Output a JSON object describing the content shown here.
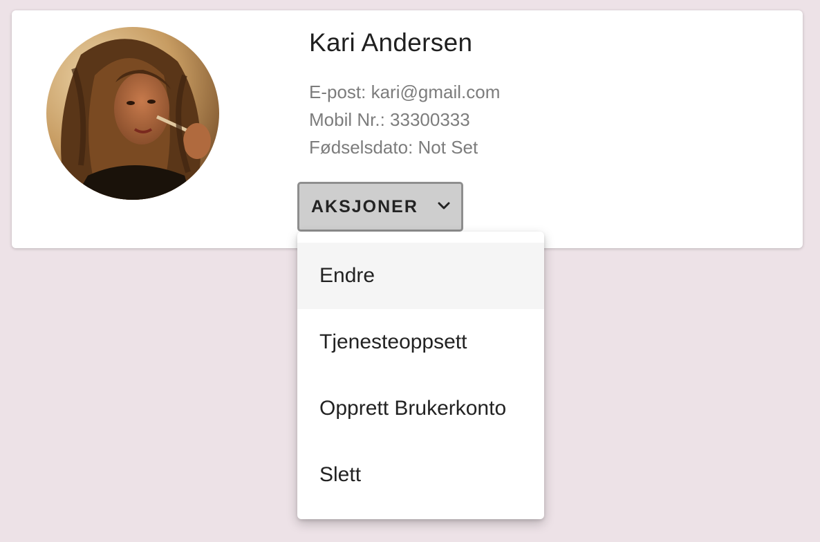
{
  "profile": {
    "name": "Kari Andersen",
    "email_line": "E-post: kari@gmail.com",
    "phone_line": "Mobil Nr.: 33300333",
    "dob_line": "Fødselsdato: Not Set"
  },
  "actions": {
    "button_label": "AKSJONER",
    "menu_items": [
      "Endre",
      "Tjenesteoppsett",
      "Opprett Brukerkonto",
      "Slett"
    ],
    "highlighted_index": 0
  },
  "colors": {
    "page_background": "#ede2e7",
    "card_background": "#ffffff",
    "button_background": "#cecece",
    "menu_highlight": "#f5f5f5",
    "secondary_text": "#7c7c7c"
  },
  "icons": {
    "dropdown": "chevron-down-icon"
  }
}
